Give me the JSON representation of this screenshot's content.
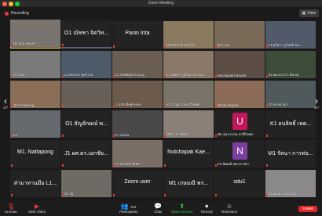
{
  "window": {
    "title": "Zoom Meeting"
  },
  "topbar": {
    "recording": "Recording",
    "view": "View"
  },
  "pager": {
    "left": "1/7",
    "right": "1/7",
    "left_arrow": "‹",
    "right_arrow": "›"
  },
  "tiles": [
    {
      "label": "มหาวิทยาลัยราชภัฏจัน",
      "center": "",
      "bg": "#6b5448",
      "active": true
    },
    {
      "label": "ผ. ตามพรายแก้ ทองสวย",
      "center": "",
      "bg": "#5a6070"
    },
    {
      "label": "",
      "center": "Pasin Inta",
      "bg": "#232323"
    },
    {
      "label": "ศรีอรัตน์ ย้อนสิงห์ ศ...",
      "center": "",
      "bg": "#8a7a60"
    },
    {
      "label": "ผู้ประชุม",
      "center": "",
      "bg": "#7a6a58"
    },
    {
      "label": "L1 ฐรัชกา ภูวิทย์ย์ พระ...",
      "center": "",
      "bg": "#505a68"
    },
    {
      "label": "L1 ขาย่า",
      "center": "",
      "bg": "#7a7a7a"
    },
    {
      "label": "L1 พรรษงร พุทรำรอ",
      "center": "",
      "bg": "#4d5a68"
    },
    {
      "label": "L1 ทรัพย์ฉัตร์ ทรุงบุบุ",
      "center": "",
      "bg": "#6a5e52"
    },
    {
      "label": "L 1 นัพชา ภูมิโสม พวกรณ์",
      "center": "",
      "bg": "#8a7868"
    },
    {
      "label": "Nutchapak Kaewsri",
      "center": "",
      "bg": "#5c4e44"
    },
    {
      "label": "02 ผศ.ดร.สาว ยิ่งยงยุ",
      "center": "",
      "bg": "#3e4c3a"
    },
    {
      "label": "Jitra Intawong",
      "center": "",
      "bg": "#8a6e58"
    },
    {
      "label": "",
      "center": "",
      "bg": "#686058"
    },
    {
      "label": "1 ปภัสรดิษฐ์ ทรพอ",
      "center": "",
      "bg": "#6c5a4a"
    },
    {
      "label": "K1 สวนสวา ทรงวีรพงศ์",
      "center": "",
      "bg": "#7a7468"
    },
    {
      "label": "Mashudingkhu",
      "center": "",
      "bg": "#8c6c58"
    },
    {
      "label": "O1 ทรงมายส",
      "center": "",
      "bg": "#505a5c"
    },
    {
      "label": "K1",
      "center": "",
      "bg": "#666a6e"
    },
    {
      "label": "",
      "center": "O1 ธัญลักษณ์ พ...",
      "bg": "#232323"
    },
    {
      "label": "P. Aurora",
      "center": "",
      "bg": "#4a4848"
    },
    {
      "label": "ชุติรา ขาวศิลป์",
      "center": "",
      "bg": "#8a8078"
    },
    {
      "label": "M1 สุมลวรรณ ชาติไทยพ",
      "center": "",
      "bg": "#232323",
      "avatar": "U",
      "avatar_bg": "#c2185b"
    },
    {
      "label": "",
      "center": "K1 ยนลิทธิ์ เหต...",
      "bg": "#232323"
    },
    {
      "label": "",
      "center": "M1. Nattapong",
      "bg": "#232323"
    },
    {
      "label": "",
      "center": "J1 ผศ.ดร.เอกชัย...",
      "bg": "#232323"
    },
    {
      "label": "F1 สินรัตน์ วิสุทธิ",
      "center": "",
      "bg": "#7a6e66"
    },
    {
      "label": "",
      "center": "Nutchapak Kae...",
      "bg": "#232323"
    },
    {
      "label": "K3 นัพมณี พยาบาลศา",
      "center": "",
      "bg": "#232323",
      "avatar": "N",
      "avatar_bg": "#7b3fa0"
    },
    {
      "label": "",
      "center": "M1 รัตนา การท่อ...",
      "bg": "#232323"
    },
    {
      "label": "",
      "center": "ส่ามาทานมือ L1...",
      "bg": "#232323"
    },
    {
      "label": "O1 รัฐ",
      "center": "",
      "bg": "#6e6a64"
    },
    {
      "label": "",
      "center": "Zoom user",
      "bg": "#232323"
    },
    {
      "label": "",
      "center": "M1 เกษมณี พร...",
      "bg": "#232323"
    },
    {
      "label": "",
      "center": "sdu1",
      "bg": "#232323"
    },
    {
      "label": "K1 ฐนพร เหตโม่สุ่ม",
      "center": "",
      "bg": "#8a8888"
    },
    {
      "label": "M1 ผรน พรมชา",
      "center": "",
      "bg": "#7a7470"
    },
    {
      "label": "",
      "center": "O1 ณัชชา จิตวิท...",
      "bg": "#232323"
    }
  ],
  "toolbar": {
    "unmute": "Unmute",
    "start_video": "Start Video",
    "participants": "Participants",
    "participants_count": "234",
    "chat": "Chat",
    "share": "Share Screen",
    "record": "Record",
    "reactions": "Reactions",
    "leave": "Leave"
  }
}
